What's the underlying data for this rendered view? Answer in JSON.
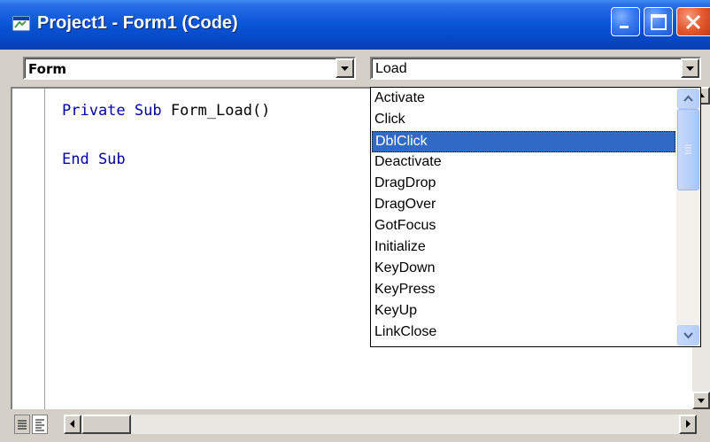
{
  "window": {
    "title": "Project1 - Form1 (Code)"
  },
  "combos": {
    "object_value": "Form",
    "procedure_value": "Load"
  },
  "code": {
    "lines": [
      {
        "keyword": "Private Sub",
        "rest": " Form_Load()"
      },
      {
        "keyword": "End Sub",
        "rest": ""
      }
    ]
  },
  "procedure_list": {
    "items": [
      "Activate",
      "Click",
      "DblClick",
      "Deactivate",
      "DragDrop",
      "DragOver",
      "GotFocus",
      "Initialize",
      "KeyDown",
      "KeyPress",
      "KeyUp",
      "LinkClose"
    ],
    "selected": "DblClick"
  },
  "colors": {
    "titlebar": "#0a57d8",
    "close_button": "#e35a2e",
    "selection": "#316ac5",
    "keyword": "#0000a0"
  },
  "icons": [
    "form-icon",
    "minimize-icon",
    "maximize-icon",
    "close-icon",
    "chevron-down-icon",
    "procedure-view-icon",
    "full-module-view-icon",
    "scroll-left-icon",
    "scroll-right-icon",
    "scroll-up-icon",
    "scroll-down-icon"
  ]
}
